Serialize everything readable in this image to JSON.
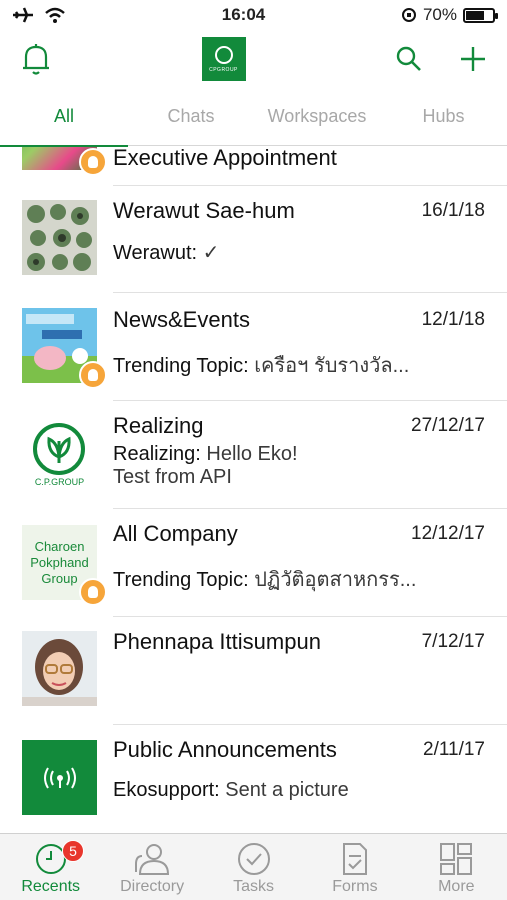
{
  "status_bar": {
    "time": "16:04",
    "battery": "70%",
    "battery_level": 0.7
  },
  "header": {
    "logo_text": "CPGROUP"
  },
  "tabs": [
    {
      "label": "All",
      "active": true
    },
    {
      "label": "Chats",
      "active": false
    },
    {
      "label": "Workspaces",
      "active": false
    },
    {
      "label": "Hubs",
      "active": false
    }
  ],
  "conversations": [
    {
      "title": "Executive Appointment",
      "date": "",
      "preview_sender": "",
      "preview": ""
    },
    {
      "title": "Werawut Sae-hum",
      "date": "16/1/18",
      "preview_sender": "Werawut:",
      "preview": " ✓"
    },
    {
      "title": "News&Events",
      "date": "12/1/18",
      "preview_sender": "Trending Topic:",
      "preview": " เครือฯ รับรางวัล..."
    },
    {
      "title": "Realizing",
      "date": "27/12/17",
      "preview_sender": "Realizing:",
      "preview": " Hello Eko!",
      "preview_line2": " Test from API",
      "logo_caption": "C.P.GROUP"
    },
    {
      "title": "All Company",
      "date": "12/12/17",
      "preview_sender": "Trending Topic:",
      "preview": " ปฏิวัติอุตสาหกรร...",
      "thumb_text": "Charoen Pokphand Group"
    },
    {
      "title": "Phennapa Ittisumpun",
      "date": "7/12/17",
      "preview_sender": "",
      "preview": ""
    },
    {
      "title": "Public Announcements",
      "date": "2/11/17",
      "preview_sender": "Ekosupport:",
      "preview": " Sent a picture"
    }
  ],
  "tabbar": [
    {
      "label": "Recents",
      "badge": "5",
      "active": true
    },
    {
      "label": "Directory"
    },
    {
      "label": "Tasks"
    },
    {
      "label": "Forms"
    },
    {
      "label": "More"
    }
  ],
  "colors": {
    "brand": "#128a3b",
    "badge": "#e8362c",
    "bulb": "#f6a53a"
  }
}
